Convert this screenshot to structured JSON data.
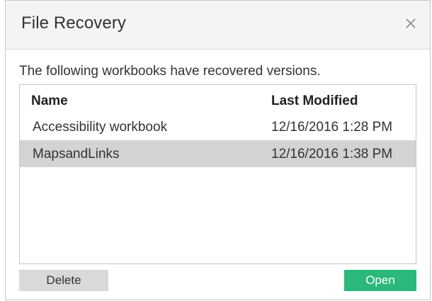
{
  "dialog": {
    "title": "File Recovery",
    "close_icon": "close-icon",
    "message": "The following workbooks have recovered versions."
  },
  "table": {
    "columns": {
      "name": "Name",
      "last_modified": "Last Modified"
    },
    "rows": [
      {
        "name": "Accessibility workbook",
        "last_modified": "12/16/2016 1:28 PM",
        "selected": false
      },
      {
        "name": "MapsandLinks",
        "last_modified": "12/16/2016 1:38 PM",
        "selected": true
      }
    ]
  },
  "buttons": {
    "delete_label": "Delete",
    "open_label": "Open"
  },
  "colors": {
    "open_button": "#2ab87b",
    "selected_row": "#d3d3d3",
    "delete_button": "#d9d9d9"
  }
}
